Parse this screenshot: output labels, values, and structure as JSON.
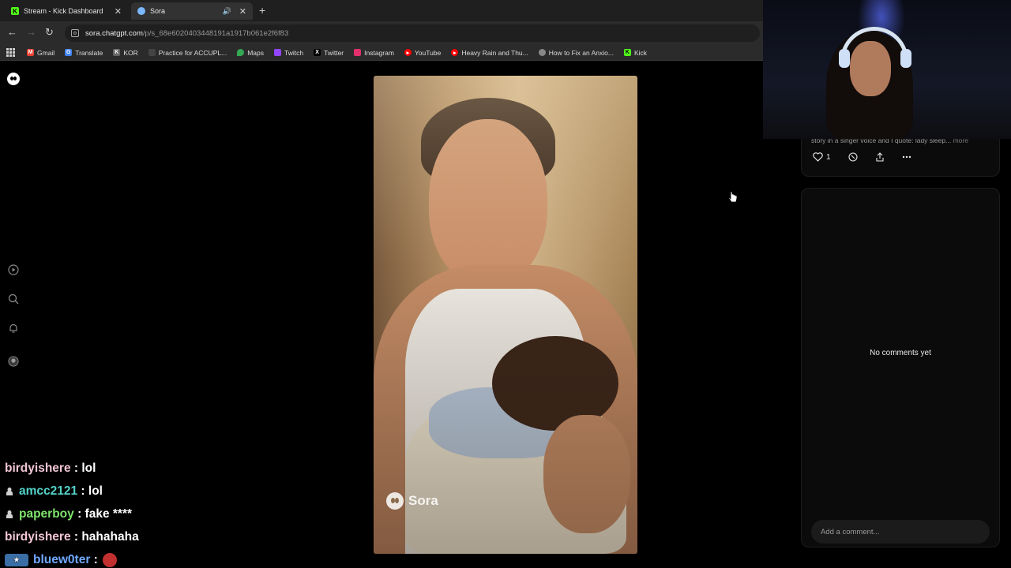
{
  "browser": {
    "tabs": [
      {
        "title": "Stream - Kick Dashboard",
        "favicon": "kick-icon",
        "color": "#53fc18"
      },
      {
        "title": "Sora",
        "favicon": "sora-icon",
        "active": true
      }
    ],
    "address": {
      "host": "sora.chatgpt.com",
      "path": "/p/s_68e6020403448191a1917b061e2f6f83"
    },
    "bookmarks": [
      {
        "label": "Gmail",
        "icon": "gmail-icon",
        "color": "#ea4335"
      },
      {
        "label": "Translate",
        "icon": "translate-icon",
        "color": "#4285f4"
      },
      {
        "label": "KOR",
        "icon": "kor-icon",
        "color": "#666666"
      },
      {
        "label": "Practice for ACCUPL...",
        "icon": "blank-icon",
        "color": "#444444"
      },
      {
        "label": "Maps",
        "icon": "maps-icon",
        "color": "#34a853"
      },
      {
        "label": "Twitch",
        "icon": "twitch-icon",
        "color": "#9146ff"
      },
      {
        "label": "Twitter",
        "icon": "x-icon",
        "color": "#000000"
      },
      {
        "label": "Instagram",
        "icon": "instagram-icon",
        "color": "#e1306c"
      },
      {
        "label": "YouTube",
        "icon": "youtube-icon",
        "color": "#ff0000"
      },
      {
        "label": "Heavy Rain and Thu...",
        "icon": "youtube-icon",
        "color": "#ff0000"
      },
      {
        "label": "How to Fix an Anxio...",
        "icon": "site-icon",
        "color": "#888888"
      },
      {
        "label": "Kick",
        "icon": "kick-icon",
        "color": "#53fc18"
      }
    ]
  },
  "sora": {
    "watermark": "Sora",
    "post": {
      "description": "story in a singer voice and I quote: lady sleep...",
      "more_label": "more",
      "like_count": "1"
    },
    "comments": {
      "empty_text": "No comments yet",
      "input_placeholder": "Add a comment..."
    }
  },
  "stream_chat": [
    {
      "user": "birdyishere",
      "message": "lol",
      "color": "#f2c6d6",
      "badge": ""
    },
    {
      "user": "amcc2121",
      "message": "lol",
      "color": "#53d3c8",
      "badge": "user-badge"
    },
    {
      "user": "paperboy",
      "message": "fake ****",
      "color": "#7ee36b",
      "badge": "user-badge"
    },
    {
      "user": "birdyishere",
      "message": "hahahaha",
      "color": "#f2c6d6",
      "badge": ""
    },
    {
      "user": "bluew0ter",
      "message": "",
      "color": "#6fa8ff",
      "badge": "sub-badge",
      "emote": true
    }
  ]
}
